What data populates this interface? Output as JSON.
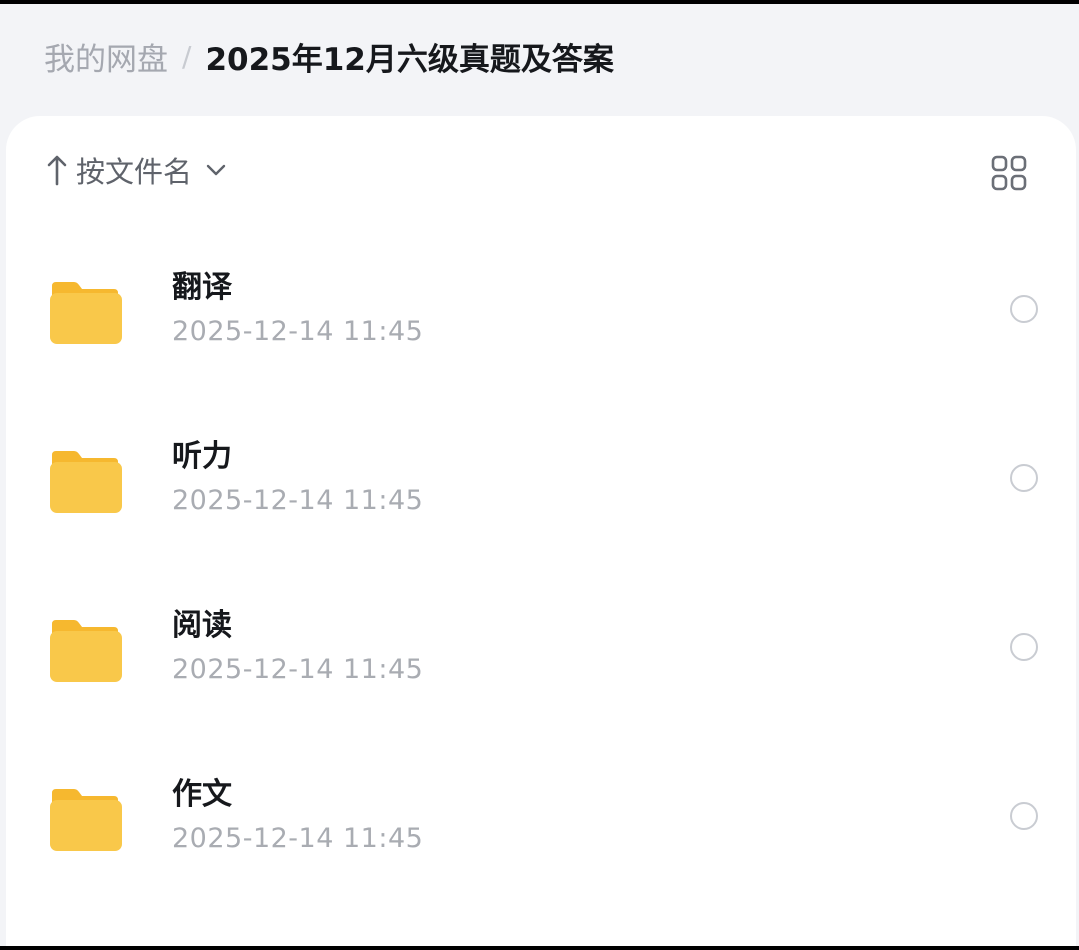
{
  "breadcrumb": {
    "root": "我的网盘",
    "separator": "/",
    "current": "2025年12月六级真题及答案"
  },
  "toolbar": {
    "sort_icon": "arrow-up-icon",
    "sort_label": "按文件名",
    "sort_dropdown_icon": "chevron-down-icon",
    "view_toggle_icon": "grid-view-icon"
  },
  "files": [
    {
      "name": "翻译",
      "modified": "2025-12-14 11:45",
      "icon": "folder-icon"
    },
    {
      "name": "听力",
      "modified": "2025-12-14 11:45",
      "icon": "folder-icon"
    },
    {
      "name": "阅读",
      "modified": "2025-12-14 11:45",
      "icon": "folder-icon"
    },
    {
      "name": "作文",
      "modified": "2025-12-14 11:45",
      "icon": "folder-icon"
    }
  ],
  "colors": {
    "folder": "#f9c84a",
    "folder_tab": "#f6b82f",
    "background": "#f3f4f7",
    "panel": "#ffffff"
  }
}
